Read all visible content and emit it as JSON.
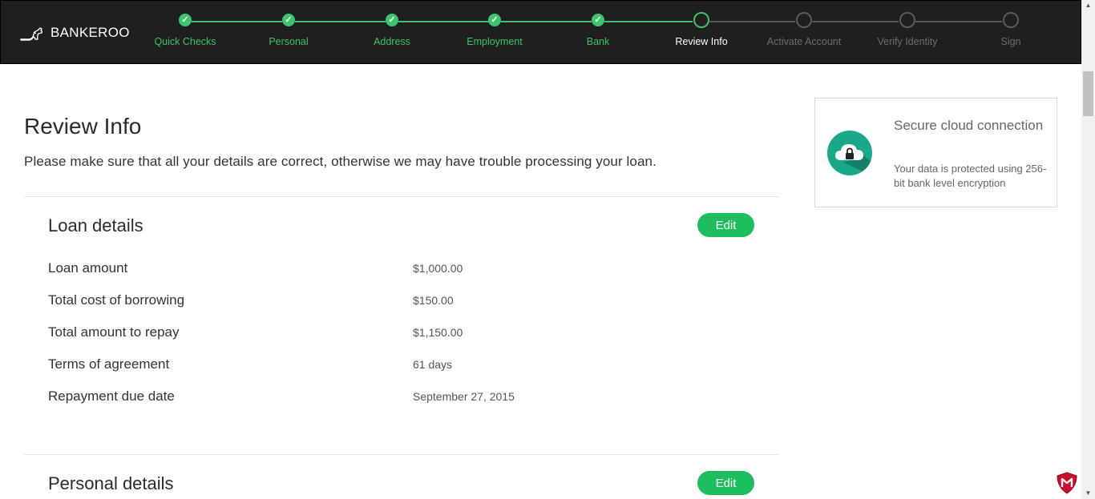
{
  "brand": {
    "name": "BANKEROO"
  },
  "steps": [
    {
      "label": "Quick Checks",
      "status": "done"
    },
    {
      "label": "Personal",
      "status": "done"
    },
    {
      "label": "Address",
      "status": "done"
    },
    {
      "label": "Employment",
      "status": "done"
    },
    {
      "label": "Bank",
      "status": "done"
    },
    {
      "label": "Review Info",
      "status": "current"
    },
    {
      "label": "Activate Account",
      "status": "todo"
    },
    {
      "label": "Verify Identity",
      "status": "todo"
    },
    {
      "label": "Sign",
      "status": "todo"
    }
  ],
  "check_glyph": "✓",
  "page": {
    "title": "Review Info",
    "intro": "Please make sure that all your details are correct, otherwise we may have trouble processing your loan."
  },
  "loan_section": {
    "title": "Loan details",
    "edit_label": "Edit",
    "rows": [
      {
        "label": "Loan amount",
        "value": "$1,000.00"
      },
      {
        "label": "Total cost of borrowing",
        "value": "$150.00"
      },
      {
        "label": "Total amount to repay",
        "value": "$1,150.00"
      },
      {
        "label": "Terms of agreement",
        "value": "61 days"
      },
      {
        "label": "Repayment due date",
        "value": "September 27, 2015"
      }
    ]
  },
  "personal_section": {
    "title": "Personal details",
    "edit_label": "Edit"
  },
  "secure_card": {
    "title": "Secure cloud connection",
    "description": "Your data is protected using 256-bit bank level encryption",
    "icon": "cloud-lock-icon"
  },
  "colors": {
    "accent_green": "#3ec46d",
    "button_green": "#1cbe5e",
    "topbar_bg": "#1f1f1f",
    "badge_teal": "#1aa88a"
  }
}
